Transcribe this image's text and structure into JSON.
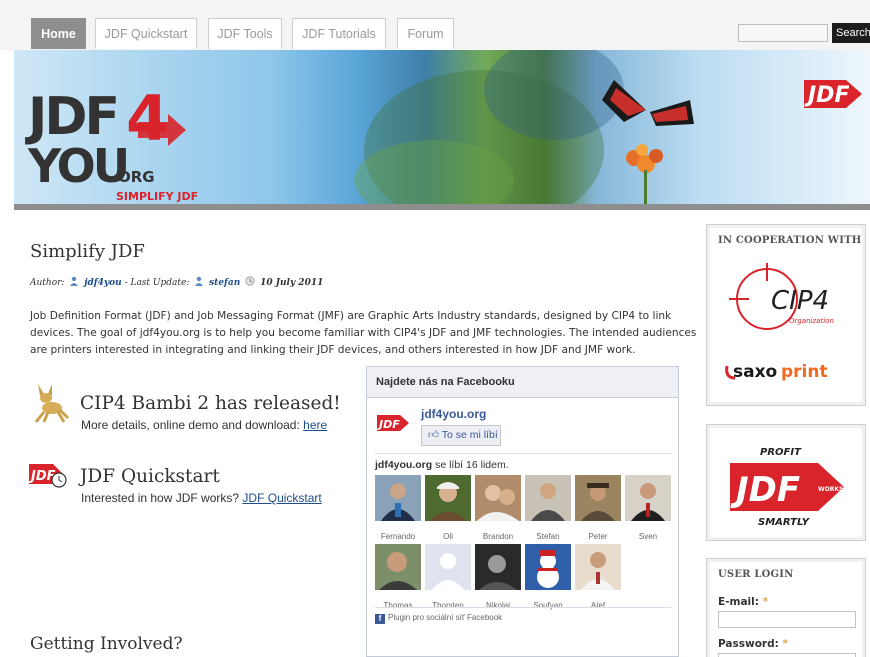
{
  "nav": {
    "tabs": [
      {
        "label": "Home",
        "active": true
      },
      {
        "label": "JDF Quickstart",
        "active": false
      },
      {
        "label": "JDF Tools",
        "active": false
      },
      {
        "label": "JDF Tutorials",
        "active": false
      },
      {
        "label": "Forum",
        "active": false
      }
    ],
    "search_button": "Search"
  },
  "banner": {
    "logo_text": "JDF4YOU.ORG",
    "tagline": "SIMPLIFY JDF",
    "corner_logo": "JDF"
  },
  "article": {
    "title": "Simplify JDF",
    "author_label": "Author:",
    "author": "jdf4you",
    "last_update_label": "Last Update:",
    "updater": "stefan",
    "date": "10 July 2011",
    "intro": "Job Definition Format (JDF) and Job Messaging Format (JMF) are Graphic Arts Industry standards, designed by CIP4 to link devices. The goal of jdf4you.org is to help you become familiar with CIP4's JDF and JMF technologies. The intended audiences are printers interested in integrating and linking their JDF devices, and others interested in how JDF and JMF work."
  },
  "features": [
    {
      "title": "CIP4 Bambi 2 has released!",
      "desc": "More details, online demo and download: ",
      "link": "here",
      "icon": "bambi-icon"
    },
    {
      "title": "JDF Quickstart",
      "desc": "Interested in how JDF works? ",
      "link": "JDF Quickstart",
      "icon": "jdf-clock-icon"
    }
  ],
  "getting_involved": "Getting Involved?",
  "facebook": {
    "header": "Najdete nás na Facebooku",
    "page_name": "jdf4you.org",
    "like_button": "To se mi líbí",
    "count_site": "jdf4you.org",
    "count_text": " se líbí 16 lidem.",
    "fans": [
      {
        "name": "Fernando"
      },
      {
        "name": "Oli"
      },
      {
        "name": "Brandon"
      },
      {
        "name": "Stefan"
      },
      {
        "name": "Peter"
      },
      {
        "name": "Sven"
      },
      {
        "name": "Thomas"
      },
      {
        "name": "Thorsten"
      },
      {
        "name": "Nikolai"
      },
      {
        "name": "Soufyan"
      },
      {
        "name": "Atef"
      }
    ],
    "footer": "Plugin pro sociální síť Facebook"
  },
  "sidebar": {
    "cooperation_title": "IN COOPERATION WITH",
    "cip4_logo": "CIP4",
    "cip4_sub": "Organization",
    "saxoprint_a": "saxo",
    "saxoprint_b": "print",
    "profit_top": "PROFIT",
    "profit_mid": "JDF",
    "profit_works": "WORKS",
    "profit_bottom": "SMARTLY",
    "login_title": "USER LOGIN",
    "email_label": "E-mail:",
    "password_label": "Password:",
    "required_mark": "*"
  },
  "colors": {
    "nav_active": "#8e8e8e",
    "link": "#1e4e8c",
    "facebook_blue": "#3b5998",
    "jdf_red": "#d8242a"
  }
}
